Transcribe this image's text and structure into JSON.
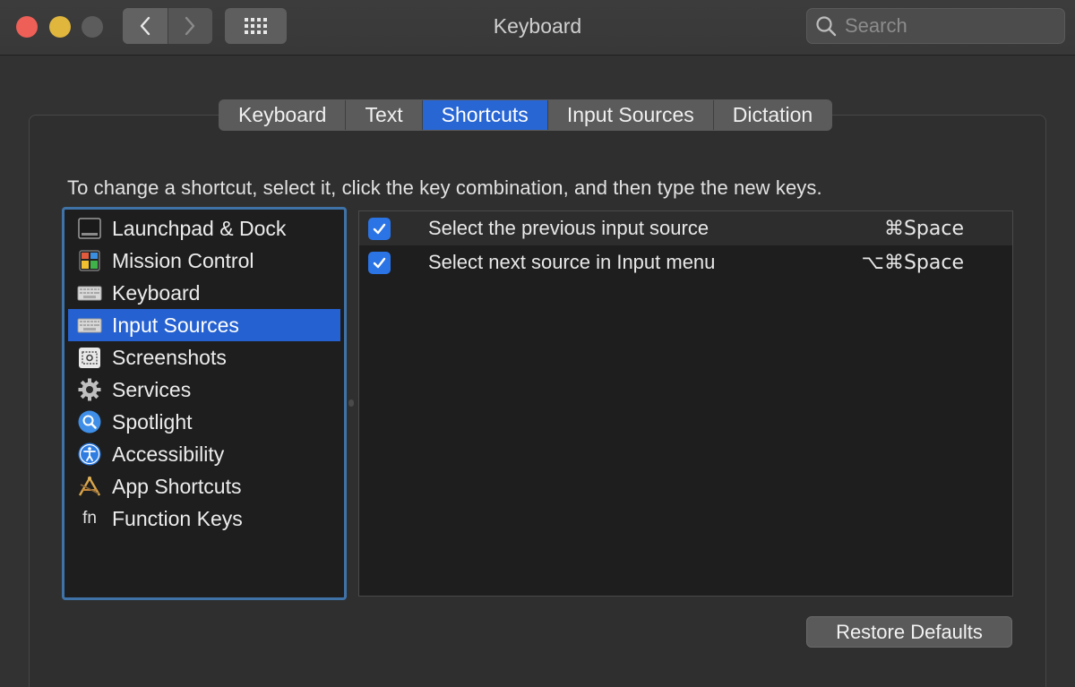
{
  "window": {
    "title": "Keyboard",
    "search_placeholder": "Search"
  },
  "tabs": [
    {
      "label": "Keyboard",
      "active": false
    },
    {
      "label": "Text",
      "active": false
    },
    {
      "label": "Shortcuts",
      "active": true
    },
    {
      "label": "Input Sources",
      "active": false
    },
    {
      "label": "Dictation",
      "active": false
    }
  ],
  "instruction": "To change a shortcut, select it, click the key combination, and then type the new keys.",
  "categories": [
    {
      "label": "Launchpad & Dock",
      "icon": "launchpad-dock-icon",
      "selected": false
    },
    {
      "label": "Mission Control",
      "icon": "mission-control-icon",
      "selected": false
    },
    {
      "label": "Keyboard",
      "icon": "keyboard-icon",
      "selected": false
    },
    {
      "label": "Input Sources",
      "icon": "keyboard-icon",
      "selected": true
    },
    {
      "label": "Screenshots",
      "icon": "screenshots-icon",
      "selected": false
    },
    {
      "label": "Services",
      "icon": "gear-icon",
      "selected": false
    },
    {
      "label": "Spotlight",
      "icon": "spotlight-icon",
      "selected": false
    },
    {
      "label": "Accessibility",
      "icon": "accessibility-icon",
      "selected": false
    },
    {
      "label": "App Shortcuts",
      "icon": "app-shortcuts-icon",
      "selected": false
    },
    {
      "label": "Function Keys",
      "icon": "fn-icon",
      "icon_text": "fn",
      "selected": false
    }
  ],
  "shortcuts": [
    {
      "checked": true,
      "label": "Select the previous input source",
      "keys": "⌘Space"
    },
    {
      "checked": true,
      "label": "Select next source in Input menu",
      "keys": "⌥⌘Space"
    }
  ],
  "restore_label": "Restore Defaults",
  "colors": {
    "accent": "#2561d0",
    "checkbox": "#2b74e6",
    "list_focus_ring": "#3f73a8"
  }
}
